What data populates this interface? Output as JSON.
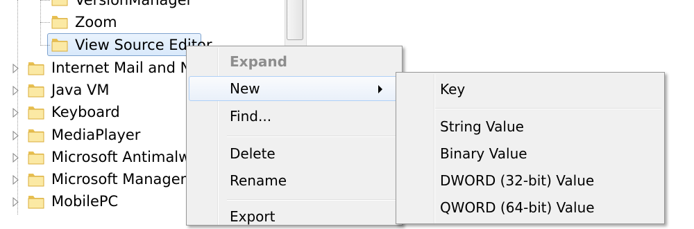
{
  "tree": {
    "items": [
      {
        "label": "VersionManager",
        "expander": false,
        "level": 2
      },
      {
        "label": "Zoom",
        "expander": false,
        "level": 2
      },
      {
        "label": "View Source Editor",
        "expander": false,
        "level": 2,
        "selected": true
      },
      {
        "label": "Internet Mail and Ne",
        "expander": true,
        "level": 1
      },
      {
        "label": "Java VM",
        "expander": true,
        "level": 1
      },
      {
        "label": "Keyboard",
        "expander": true,
        "level": 1
      },
      {
        "label": "MediaPlayer",
        "expander": true,
        "level": 1
      },
      {
        "label": "Microsoft Antimalwa",
        "expander": true,
        "level": 1
      },
      {
        "label": "Microsoft Managem",
        "expander": true,
        "level": 1
      },
      {
        "label": "MobilePC",
        "expander": true,
        "level": 1
      }
    ]
  },
  "context_menu": {
    "items": [
      {
        "label": "Expand",
        "disabled": true
      },
      {
        "label": "New",
        "has_submenu": true,
        "highlighted": true
      },
      {
        "label": "Find..."
      },
      {
        "label": "Delete"
      },
      {
        "label": "Rename"
      },
      {
        "label": "Export"
      }
    ]
  },
  "submenu": {
    "items": [
      {
        "label": "Key"
      },
      {
        "label": "String Value"
      },
      {
        "label": "Binary Value"
      },
      {
        "label": "DWORD (32-bit) Value"
      },
      {
        "label": "QWORD (64-bit) Value"
      }
    ]
  },
  "colors": {
    "folder_light": "#fbe9a4",
    "folder_dark": "#e8c052",
    "highlight_border": "#aecff7",
    "menu_bg": "#f0f0f0"
  }
}
